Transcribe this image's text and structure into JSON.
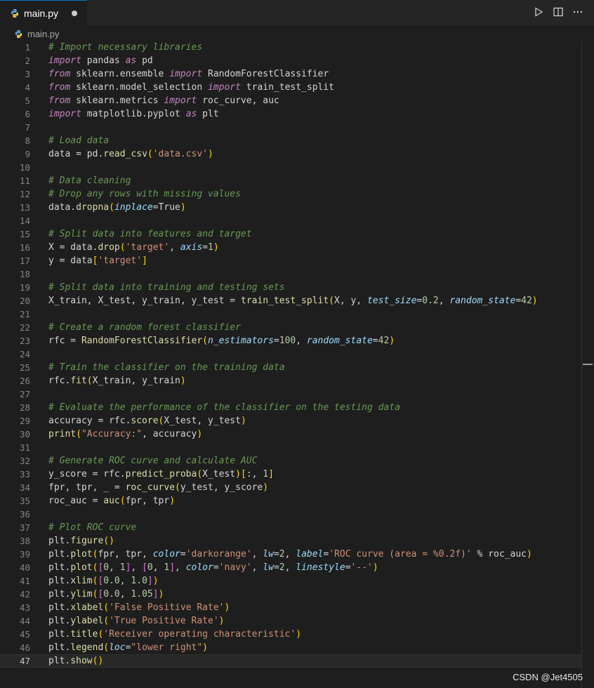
{
  "tab": {
    "filename": "main.py",
    "icon": "python-file-icon",
    "modified": true
  },
  "breadcrumb": {
    "file": "main.py"
  },
  "actions": [
    {
      "name": "run-button",
      "icon": "play-icon"
    },
    {
      "name": "split-editor-button",
      "icon": "split-icon"
    },
    {
      "name": "more-actions-button",
      "icon": "ellipsis-icon"
    }
  ],
  "editor": {
    "current_line": 47,
    "lines": [
      [
        [
          "cm",
          "# Import necessary libraries"
        ]
      ],
      [
        [
          "kw",
          "import"
        ],
        [
          "p",
          " pandas "
        ],
        [
          "kw",
          "as"
        ],
        [
          "p",
          " pd"
        ]
      ],
      [
        [
          "kw",
          "from"
        ],
        [
          "p",
          " sklearn.ensemble "
        ],
        [
          "kw",
          "import"
        ],
        [
          "p",
          " RandomForestClassifier"
        ]
      ],
      [
        [
          "kw",
          "from"
        ],
        [
          "p",
          " sklearn.model_selection "
        ],
        [
          "kw",
          "import"
        ],
        [
          "p",
          " train_test_split"
        ]
      ],
      [
        [
          "kw",
          "from"
        ],
        [
          "p",
          " sklearn.metrics "
        ],
        [
          "kw",
          "import"
        ],
        [
          "p",
          " roc_curve, auc"
        ]
      ],
      [
        [
          "kw",
          "import"
        ],
        [
          "p",
          " matplotlib.pyplot "
        ],
        [
          "kw",
          "as"
        ],
        [
          "p",
          " plt"
        ]
      ],
      [],
      [
        [
          "cm",
          "# Load data"
        ]
      ],
      [
        [
          "p",
          "data = pd."
        ],
        [
          "fn",
          "read_csv"
        ],
        [
          "br1",
          "("
        ],
        [
          "str",
          "'data.csv'"
        ],
        [
          "br1",
          ")"
        ]
      ],
      [],
      [
        [
          "cm",
          "# Data cleaning"
        ]
      ],
      [
        [
          "cm",
          "# Drop any rows with missing values"
        ]
      ],
      [
        [
          "p",
          "data."
        ],
        [
          "fn",
          "dropna"
        ],
        [
          "br1",
          "("
        ],
        [
          "prm",
          "inplace"
        ],
        [
          "p",
          "=True"
        ],
        [
          "br1",
          ")"
        ]
      ],
      [],
      [
        [
          "cm",
          "# Split data into features and target"
        ]
      ],
      [
        [
          "p",
          "X = data."
        ],
        [
          "fn",
          "drop"
        ],
        [
          "br1",
          "("
        ],
        [
          "str",
          "'target'"
        ],
        [
          "p",
          ", "
        ],
        [
          "prm",
          "axis"
        ],
        [
          "p",
          "="
        ],
        [
          "num",
          "1"
        ],
        [
          "br1",
          ")"
        ]
      ],
      [
        [
          "p",
          "y = data"
        ],
        [
          "br1",
          "["
        ],
        [
          "str",
          "'target'"
        ],
        [
          "br1",
          "]"
        ]
      ],
      [],
      [
        [
          "cm",
          "# Split data into training and testing sets"
        ]
      ],
      [
        [
          "p",
          "X_train, X_test, y_train, y_test = "
        ],
        [
          "fn",
          "train_test_split"
        ],
        [
          "br1",
          "("
        ],
        [
          "p",
          "X, y, "
        ],
        [
          "prm",
          "test_size"
        ],
        [
          "p",
          "="
        ],
        [
          "num",
          "0.2"
        ],
        [
          "p",
          ", "
        ],
        [
          "prm",
          "random_state"
        ],
        [
          "p",
          "="
        ],
        [
          "num",
          "42"
        ],
        [
          "br1",
          ")"
        ]
      ],
      [],
      [
        [
          "cm",
          "# Create a random forest classifier"
        ]
      ],
      [
        [
          "p",
          "rfc = "
        ],
        [
          "fn",
          "RandomForestClassifier"
        ],
        [
          "br1",
          "("
        ],
        [
          "prm",
          "n_estimators"
        ],
        [
          "p",
          "="
        ],
        [
          "num",
          "100"
        ],
        [
          "p",
          ", "
        ],
        [
          "prm",
          "random_state"
        ],
        [
          "p",
          "="
        ],
        [
          "num",
          "42"
        ],
        [
          "br1",
          ")"
        ]
      ],
      [],
      [
        [
          "cm",
          "# Train the classifier on the training data"
        ]
      ],
      [
        [
          "p",
          "rfc."
        ],
        [
          "fn",
          "fit"
        ],
        [
          "br1",
          "("
        ],
        [
          "p",
          "X_train, y_train"
        ],
        [
          "br1",
          ")"
        ]
      ],
      [],
      [
        [
          "cm",
          "# Evaluate the performance of the classifier on the testing data"
        ]
      ],
      [
        [
          "p",
          "accuracy = rfc."
        ],
        [
          "fn",
          "score"
        ],
        [
          "br1",
          "("
        ],
        [
          "p",
          "X_test, y_test"
        ],
        [
          "br1",
          ")"
        ]
      ],
      [
        [
          "fn",
          "print"
        ],
        [
          "br1",
          "("
        ],
        [
          "str",
          "\"Accuracy:\""
        ],
        [
          "p",
          ", accuracy"
        ],
        [
          "br1",
          ")"
        ]
      ],
      [],
      [
        [
          "cm",
          "# Generate ROC curve and calculate AUC"
        ]
      ],
      [
        [
          "p",
          "y_score = rfc."
        ],
        [
          "fn",
          "predict_proba"
        ],
        [
          "br1",
          "("
        ],
        [
          "p",
          "X_test"
        ],
        [
          "br1",
          ")"
        ],
        [
          "br1",
          "["
        ],
        [
          "p",
          ":, "
        ],
        [
          "num",
          "1"
        ],
        [
          "br1",
          "]"
        ]
      ],
      [
        [
          "p",
          "fpr, tpr, _ = "
        ],
        [
          "fn",
          "roc_curve"
        ],
        [
          "br1",
          "("
        ],
        [
          "p",
          "y_test, y_score"
        ],
        [
          "br1",
          ")"
        ]
      ],
      [
        [
          "p",
          "roc_auc = "
        ],
        [
          "fn",
          "auc"
        ],
        [
          "br1",
          "("
        ],
        [
          "p",
          "fpr, tpr"
        ],
        [
          "br1",
          ")"
        ]
      ],
      [],
      [
        [
          "cm",
          "# Plot ROC curve"
        ]
      ],
      [
        [
          "p",
          "plt."
        ],
        [
          "fn",
          "figure"
        ],
        [
          "br1",
          "()"
        ]
      ],
      [
        [
          "p",
          "plt."
        ],
        [
          "fn",
          "plot"
        ],
        [
          "br1",
          "("
        ],
        [
          "p",
          "fpr, tpr, "
        ],
        [
          "prm",
          "color"
        ],
        [
          "p",
          "="
        ],
        [
          "str",
          "'darkorange'"
        ],
        [
          "p",
          ", "
        ],
        [
          "prm",
          "lw"
        ],
        [
          "p",
          "="
        ],
        [
          "num",
          "2"
        ],
        [
          "p",
          ", "
        ],
        [
          "prm",
          "label"
        ],
        [
          "p",
          "="
        ],
        [
          "str",
          "'ROC curve (area = %0.2f)'"
        ],
        [
          "p",
          " % roc_auc"
        ],
        [
          "br1",
          ")"
        ]
      ],
      [
        [
          "p",
          "plt."
        ],
        [
          "fn",
          "plot"
        ],
        [
          "br1",
          "("
        ],
        [
          "br2",
          "["
        ],
        [
          "num",
          "0"
        ],
        [
          "p",
          ", "
        ],
        [
          "num",
          "1"
        ],
        [
          "br2",
          "]"
        ],
        [
          "p",
          ", "
        ],
        [
          "br2",
          "["
        ],
        [
          "num",
          "0"
        ],
        [
          "p",
          ", "
        ],
        [
          "num",
          "1"
        ],
        [
          "br2",
          "]"
        ],
        [
          "p",
          ", "
        ],
        [
          "prm",
          "color"
        ],
        [
          "p",
          "="
        ],
        [
          "str",
          "'navy'"
        ],
        [
          "p",
          ", "
        ],
        [
          "prm",
          "lw"
        ],
        [
          "p",
          "="
        ],
        [
          "num",
          "2"
        ],
        [
          "p",
          ", "
        ],
        [
          "prm",
          "linestyle"
        ],
        [
          "p",
          "="
        ],
        [
          "str",
          "'--'"
        ],
        [
          "br1",
          ")"
        ]
      ],
      [
        [
          "p",
          "plt."
        ],
        [
          "fn",
          "xlim"
        ],
        [
          "br1",
          "("
        ],
        [
          "br2",
          "["
        ],
        [
          "num",
          "0.0"
        ],
        [
          "p",
          ", "
        ],
        [
          "num",
          "1.0"
        ],
        [
          "br2",
          "]"
        ],
        [
          "br1",
          ")"
        ]
      ],
      [
        [
          "p",
          "plt."
        ],
        [
          "fn",
          "ylim"
        ],
        [
          "br1",
          "("
        ],
        [
          "br2",
          "["
        ],
        [
          "num",
          "0.0"
        ],
        [
          "p",
          ", "
        ],
        [
          "num",
          "1.05"
        ],
        [
          "br2",
          "]"
        ],
        [
          "br1",
          ")"
        ]
      ],
      [
        [
          "p",
          "plt."
        ],
        [
          "fn",
          "xlabel"
        ],
        [
          "br1",
          "("
        ],
        [
          "str",
          "'False Positive Rate'"
        ],
        [
          "br1",
          ")"
        ]
      ],
      [
        [
          "p",
          "plt."
        ],
        [
          "fn",
          "ylabel"
        ],
        [
          "br1",
          "("
        ],
        [
          "str",
          "'True Positive Rate'"
        ],
        [
          "br1",
          ")"
        ]
      ],
      [
        [
          "p",
          "plt."
        ],
        [
          "fn",
          "title"
        ],
        [
          "br1",
          "("
        ],
        [
          "str",
          "'Receiver operating characteristic'"
        ],
        [
          "br1",
          ")"
        ]
      ],
      [
        [
          "p",
          "plt."
        ],
        [
          "fn",
          "legend"
        ],
        [
          "br1",
          "("
        ],
        [
          "prm",
          "loc"
        ],
        [
          "p",
          "="
        ],
        [
          "str",
          "\"lower right\""
        ],
        [
          "br1",
          ")"
        ]
      ],
      [
        [
          "p",
          "plt."
        ],
        [
          "fn",
          "show"
        ],
        [
          "br1",
          "()"
        ]
      ]
    ]
  },
  "watermark": "CSDN @Jet4505"
}
